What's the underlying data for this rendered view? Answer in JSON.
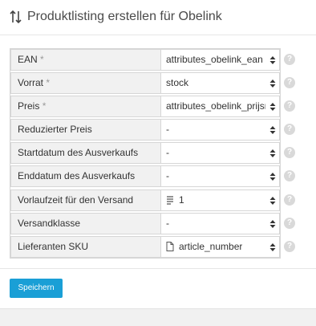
{
  "header": {
    "title": "Produktlisting erstellen für Obelink",
    "icon": "sort-arrows-icon"
  },
  "form": {
    "rows": [
      {
        "label": "EAN",
        "required": "*",
        "value": "attributes_obelink_ean",
        "icon": ""
      },
      {
        "label": "Vorrat",
        "required": "*",
        "value": "stock",
        "icon": ""
      },
      {
        "label": "Preis",
        "required": "*",
        "value": "attributes_obelink_prijsnl",
        "icon": ""
      },
      {
        "label": "Reduzierter Preis",
        "required": "",
        "value": "-",
        "icon": ""
      },
      {
        "label": "Startdatum des Ausverkaufs",
        "required": "",
        "value": "-",
        "icon": ""
      },
      {
        "label": "Enddatum des Ausverkaufs",
        "required": "",
        "value": "-",
        "icon": ""
      },
      {
        "label": "Vorlaufzeit für den Versand",
        "required": "",
        "value": "1",
        "icon": "list-icon"
      },
      {
        "label": "Versandklasse",
        "required": "",
        "value": "-",
        "icon": ""
      },
      {
        "label": "Lieferanten SKU",
        "required": "",
        "value": "article_number",
        "icon": "file-icon"
      }
    ],
    "help_glyph": "?"
  },
  "actions": {
    "save_label": "Speichern"
  },
  "colors": {
    "accent": "#1a9fd6",
    "label_bg": "#f1f1f1",
    "border": "#d6d6d6",
    "help_bg": "#d9d9d9"
  }
}
